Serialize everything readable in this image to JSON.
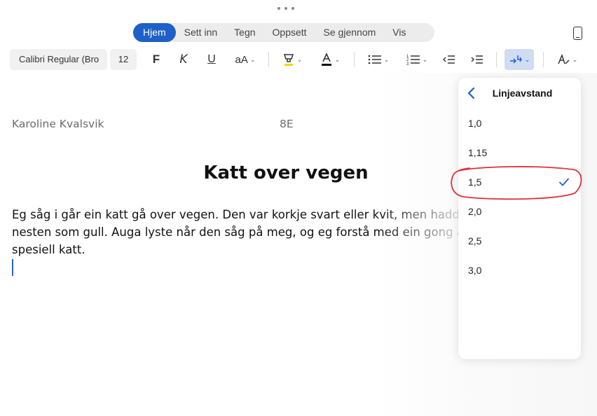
{
  "ribbon": {
    "tabs": [
      "Hjem",
      "Sett inn",
      "Tegn",
      "Oppsett",
      "Se gjennom",
      "Vis"
    ],
    "active_tab": "Hjem"
  },
  "toolbar": {
    "font_name": "Calibri Regular (Bro",
    "font_size": "12",
    "bold_label": "F",
    "italic_label": "K",
    "underline_label": "U",
    "text_size_label": "aA",
    "highlight_color": "#f2d700",
    "font_color": "#111111",
    "accent": "#1f5fc8",
    "icons": [
      "highlighter-icon",
      "font-color-icon",
      "bullets-icon",
      "numbering-icon",
      "decrease-indent-icon",
      "increase-indent-icon",
      "line-spacing-icon",
      "styles-icon"
    ]
  },
  "document": {
    "author": "Karoline Kvalsvik",
    "class": "8E",
    "title": "Katt over vegen",
    "lines": [
      "Eg såg i går ein katt gå over vegen. Den var korkje svart eller kvit, men hadde",
      "nesten som gull. Auga lyste når den såg på meg, og eg forstå med ein gong a",
      "spesiell katt."
    ]
  },
  "line_spacing_menu": {
    "title": "Linjeavstand",
    "options": [
      "1,0",
      "1,15",
      "1,5",
      "2,0",
      "2,5",
      "3,0"
    ],
    "selected": "1,5"
  }
}
